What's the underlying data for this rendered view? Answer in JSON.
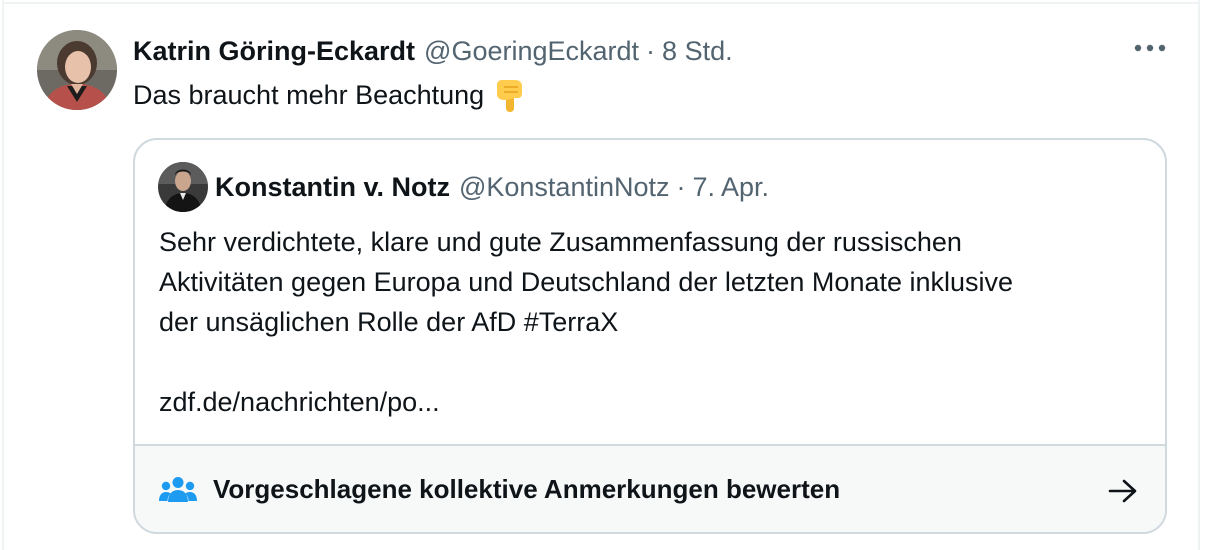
{
  "tweet": {
    "author": {
      "name": "Katrin Göring-Eckardt",
      "handle": "@GoeringEckardt",
      "separator": "·",
      "time": "8 Std.",
      "avatar_icon": "avatar-photo"
    },
    "text": "Das braucht mehr Beachtung",
    "emoji": "backhand-index-pointing-down-emoji",
    "more_icon": "more-options-icon"
  },
  "quote": {
    "author": {
      "name": "Konstantin v. Notz",
      "handle": "@KonstantinNotz",
      "separator": "·",
      "time": "7. Apr.",
      "avatar_icon": "avatar-photo"
    },
    "lines": [
      "Sehr verdichtete, klare und gute Zusammenfassung der russischen",
      "Aktivitäten gegen Europa und Deutschland der letzten Monate inklusive",
      "der unsäglichen Rolle der AfD #TerraX"
    ],
    "link": "zdf.de/nachrichten/po..."
  },
  "community_notes": {
    "label": "Vorgeschlagene kollektive Anmerkungen bewerten",
    "icon": "people-icon",
    "arrow": "arrow-right-icon",
    "accent_color": "#1d9bf0"
  },
  "colors": {
    "text_primary": "#0f1419",
    "text_secondary": "#536471",
    "border": "#cfd9de",
    "notes_background": "#f7f9f9"
  }
}
